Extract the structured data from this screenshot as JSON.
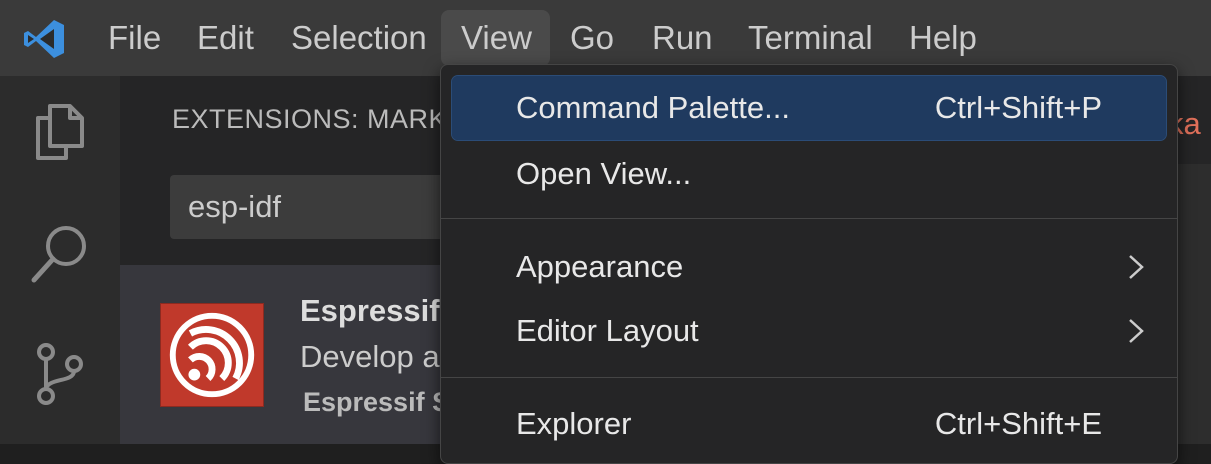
{
  "menubar": {
    "items": [
      {
        "label": "File"
      },
      {
        "label": "Edit"
      },
      {
        "label": "Selection"
      },
      {
        "label": "View"
      },
      {
        "label": "Go"
      },
      {
        "label": "Run"
      },
      {
        "label": "Terminal"
      },
      {
        "label": "Help"
      }
    ],
    "active": "View"
  },
  "activity_bar": {
    "icons": [
      "explorer-icon",
      "search-icon",
      "source-control-icon"
    ]
  },
  "sidebar": {
    "title": "EXTENSIONS: MARKET",
    "search_value": "esp-idf",
    "extension": {
      "name": "Espressif",
      "description": "Develop a",
      "publisher": "Espressif S",
      "icon": "espressif-logo"
    },
    "right_text": "ka"
  },
  "view_menu": {
    "items": [
      {
        "label": "Command Palette...",
        "shortcut": "Ctrl+Shift+P",
        "selected": true
      },
      {
        "label": "Open View...",
        "shortcut": ""
      },
      {
        "label": "Appearance",
        "submenu": true
      },
      {
        "label": "Editor Layout",
        "submenu": true
      },
      {
        "label": "Explorer",
        "shortcut": "Ctrl+Shift+E"
      }
    ]
  },
  "colors": {
    "accent": "#1f3a5f",
    "espressif_red": "#c0392b",
    "vscode_blue": "#3c8fde"
  }
}
